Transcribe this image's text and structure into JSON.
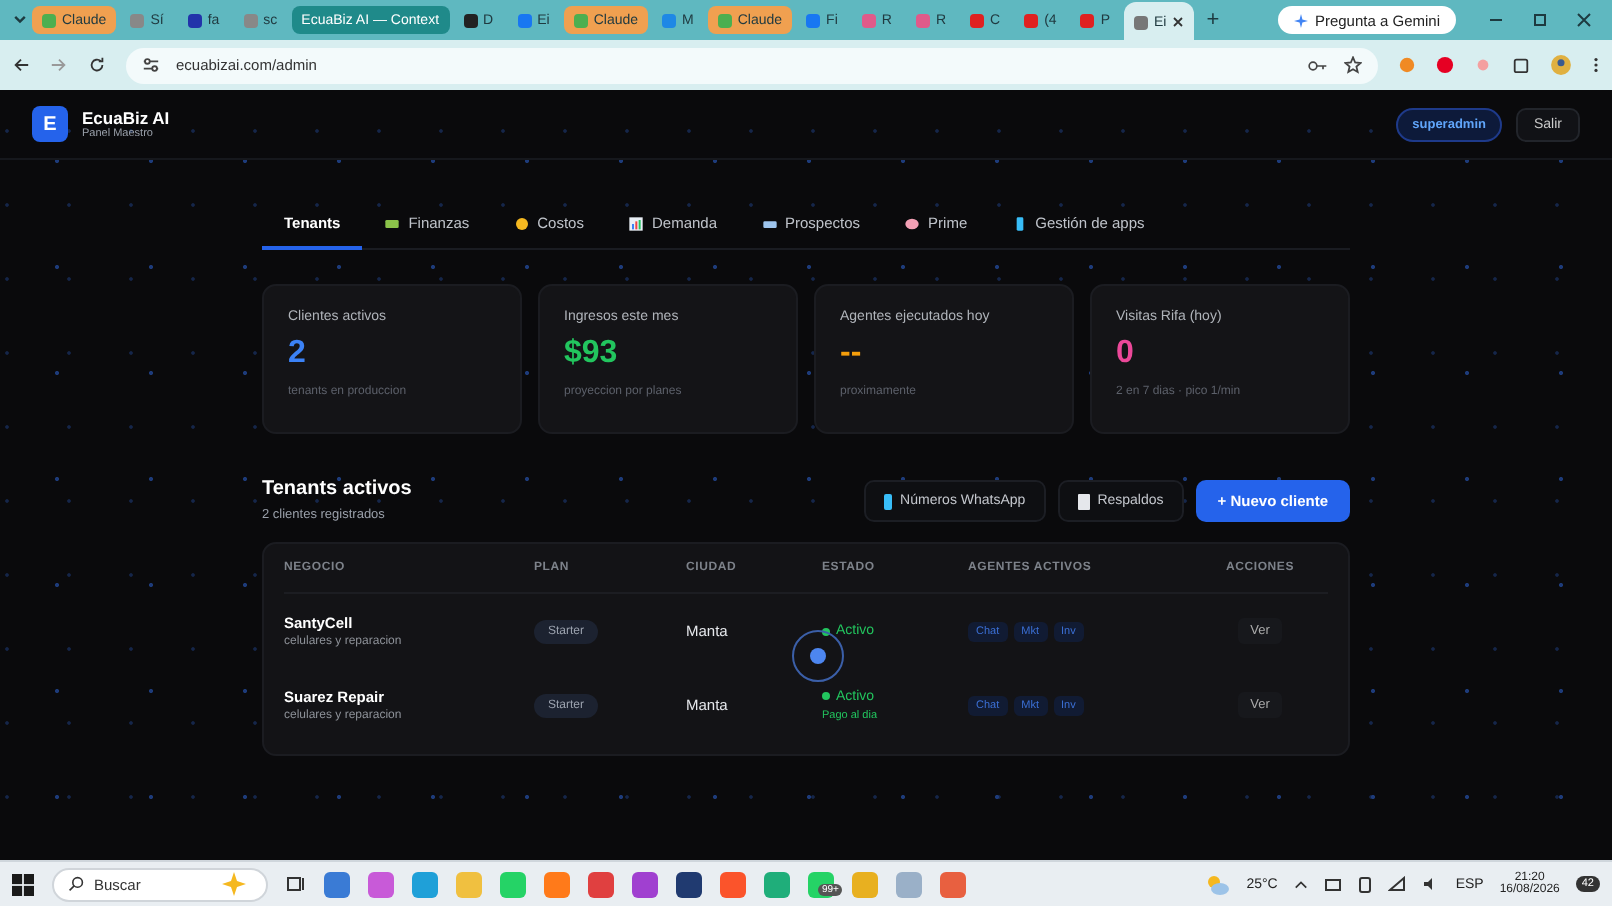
{
  "browser": {
    "tabs": [
      {
        "label": "Claude",
        "selected": false,
        "color": "#f0a050"
      },
      {
        "label": "Sí",
        "selected": false
      },
      {
        "label": "fa",
        "selected": false
      },
      {
        "label": "sc",
        "selected": false
      },
      {
        "label": "EcuaBiz AI — Context",
        "selected": false,
        "color": "#1f8a8a"
      },
      {
        "label": "D",
        "selected": false
      },
      {
        "label": "Ei",
        "selected": false
      },
      {
        "label": "Claude",
        "selected": false,
        "color": "#f0a050"
      },
      {
        "label": "M",
        "selected": false
      },
      {
        "label": "Claude",
        "selected": false,
        "color": "#f0a050"
      },
      {
        "label": "Fi",
        "selected": false
      },
      {
        "label": "R",
        "selected": false
      },
      {
        "label": "R",
        "selected": false
      },
      {
        "label": "C",
        "selected": false
      },
      {
        "label": "(4",
        "selected": false
      },
      {
        "label": "P",
        "selected": false
      },
      {
        "label": "Ei",
        "selected": true
      }
    ],
    "new_tab": "+",
    "gemini": "Pregunta a Gemini",
    "url": "ecuabizai.com/admin"
  },
  "app": {
    "logo": "E",
    "name": "EcuaBiz AI",
    "subtitle": "Panel Maestro",
    "role": "superadmin",
    "logout": "Salir"
  },
  "nav": [
    {
      "label": "Tenants",
      "selected": true
    },
    {
      "label": "Finanzas",
      "selected": false
    },
    {
      "label": "Costos",
      "selected": false
    },
    {
      "label": "Demanda",
      "selected": false
    },
    {
      "label": "Prospectos",
      "selected": false
    },
    {
      "label": "Prime",
      "selected": false
    },
    {
      "label": "Gestión de apps",
      "selected": false
    }
  ],
  "stats": [
    {
      "label": "Clientes activos",
      "value": "2",
      "note": "tenants en produccion",
      "color": "#3b82f6"
    },
    {
      "label": "Ingresos este mes",
      "value": "$93",
      "note": "proyeccion por planes",
      "color": "#22c55e"
    },
    {
      "label": "Agentes ejecutados hoy",
      "value": "--",
      "note": "proximamente",
      "color": "#f59e0b"
    },
    {
      "label": "Visitas Rifa (hoy)",
      "value": "0",
      "note": "2 en 7 dias · pico 1/min",
      "color": "#ec4899"
    }
  ],
  "section": {
    "title": "Tenants activos",
    "subtitle": "2 clientes registrados",
    "buttons": [
      "Números WhatsApp",
      "Respaldos"
    ],
    "primary": "+ Nuevo cliente"
  },
  "table": {
    "columns": [
      "NEGOCIO",
      "PLAN",
      "CIUDAD",
      "ESTADO",
      "AGENTES ACTIVOS",
      "ACCIONES"
    ],
    "rows": [
      {
        "name": "SantyCell",
        "description": "celulares y reparacion",
        "plan": "Starter",
        "city": "Manta",
        "status": "Activo",
        "agents": [
          "Chat",
          "Mkt",
          "Inv"
        ],
        "action": "Ver"
      },
      {
        "name": "Suarez Repair",
        "description": "celulares y reparacion",
        "plan": "Starter",
        "city": "Manta",
        "status": "Activo",
        "status_note": "Pago al dia",
        "agents": [
          "Chat",
          "Mkt",
          "Inv"
        ],
        "action": "Ver"
      }
    ]
  },
  "taskbar": {
    "search": "Buscar",
    "badge": "99+",
    "temperature": "25°C",
    "language": "ESP",
    "time": "21:20",
    "date": "16/08/2026",
    "notifications": "42"
  }
}
